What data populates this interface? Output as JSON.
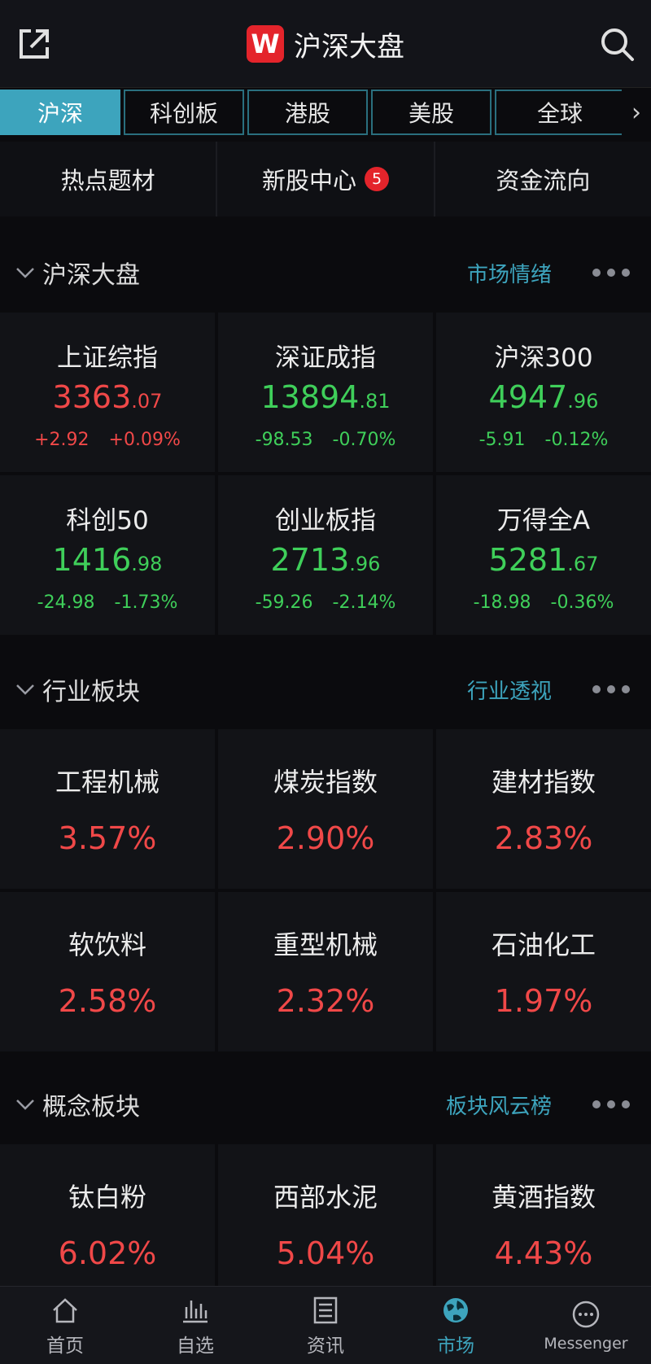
{
  "header": {
    "title": "沪深大盘",
    "logo_letter": "W"
  },
  "tabs": [
    {
      "label": "沪深",
      "active": true
    },
    {
      "label": "科创板",
      "active": false
    },
    {
      "label": "港股",
      "active": false
    },
    {
      "label": "美股",
      "active": false
    },
    {
      "label": "全球",
      "active": false
    }
  ],
  "quick": {
    "hot": "热点题材",
    "ipo": "新股中心",
    "ipo_badge": "5",
    "flow": "资金流向"
  },
  "market": {
    "title": "沪深大盘",
    "link": "市场情绪",
    "indices": [
      {
        "name": "上证综指",
        "int": "3363",
        "dec": ".07",
        "chg": "+2.92",
        "pct": "+0.09%",
        "dir": "up"
      },
      {
        "name": "深证成指",
        "int": "13894",
        "dec": ".81",
        "chg": "-98.53",
        "pct": "-0.70%",
        "dir": "down"
      },
      {
        "name": "沪深300",
        "int": "4947",
        "dec": ".96",
        "chg": "-5.91",
        "pct": "-0.12%",
        "dir": "down"
      },
      {
        "name": "科创50",
        "int": "1416",
        "dec": ".98",
        "chg": "-24.98",
        "pct": "-1.73%",
        "dir": "down"
      },
      {
        "name": "创业板指",
        "int": "2713",
        "dec": ".96",
        "chg": "-59.26",
        "pct": "-2.14%",
        "dir": "down"
      },
      {
        "name": "万得全A",
        "int": "5281",
        "dec": ".67",
        "chg": "-18.98",
        "pct": "-0.36%",
        "dir": "down"
      }
    ]
  },
  "industry": {
    "title": "行业板块",
    "link": "行业透视",
    "items": [
      {
        "name": "工程机械",
        "pct": "3.57%"
      },
      {
        "name": "煤炭指数",
        "pct": "2.90%"
      },
      {
        "name": "建材指数",
        "pct": "2.83%"
      },
      {
        "name": "软饮料",
        "pct": "2.58%"
      },
      {
        "name": "重型机械",
        "pct": "2.32%"
      },
      {
        "name": "石油化工",
        "pct": "1.97%"
      }
    ]
  },
  "concept": {
    "title": "概念板块",
    "link": "板块风云榜",
    "items": [
      {
        "name": "钛白粉",
        "pct": "6.02%"
      },
      {
        "name": "西部水泥",
        "pct": "5.04%"
      },
      {
        "name": "黄酒指数",
        "pct": "4.43%"
      }
    ]
  },
  "nav": [
    {
      "label": "首页",
      "icon": "home-icon"
    },
    {
      "label": "自选",
      "icon": "chart-icon"
    },
    {
      "label": "资讯",
      "icon": "news-icon"
    },
    {
      "label": "市场",
      "icon": "globe-icon",
      "active": true
    },
    {
      "label": "Messenger",
      "icon": "chat-icon"
    }
  ],
  "colors": {
    "accent": "#3da4bd",
    "up": "#f04848",
    "down": "#3fcf5a",
    "logo": "#e4242b"
  }
}
